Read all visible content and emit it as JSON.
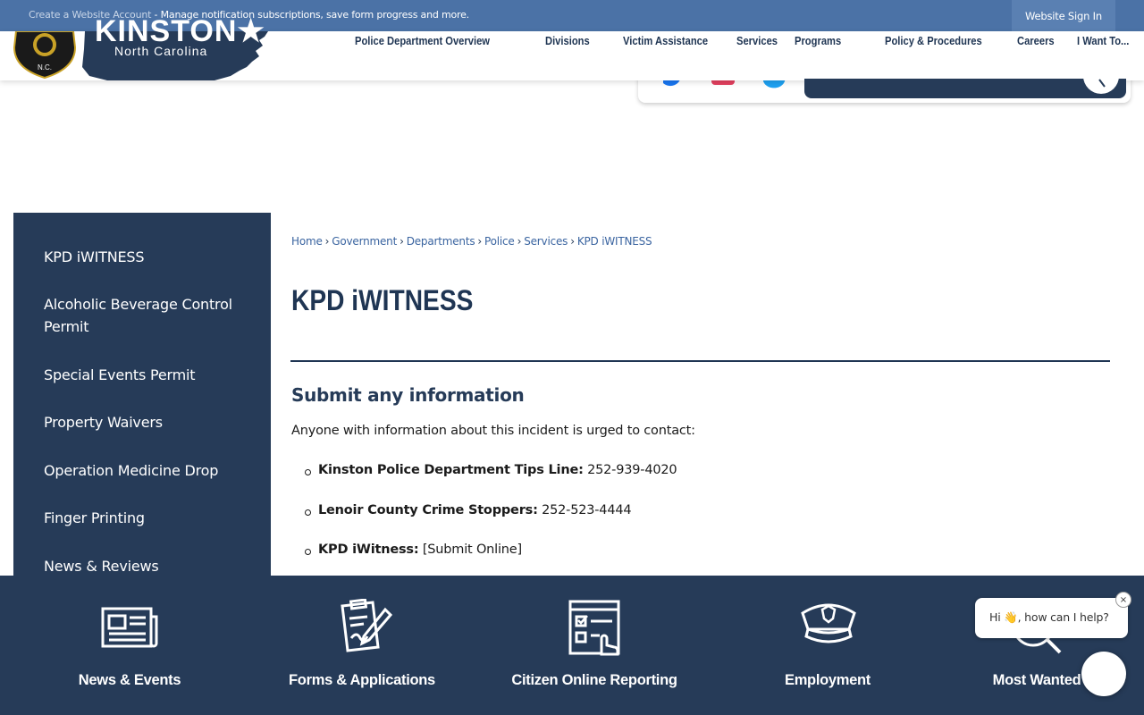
{
  "notification": {
    "link_text": "Create a Website Account",
    "message": " - Manage notification subscriptions, save form progress and more.",
    "signin_label": "Website Sign In"
  },
  "logo": {
    "wordmark": "KINSTON",
    "star": "★",
    "subtitle": "North Carolina",
    "seal_text": "N.C."
  },
  "nav": {
    "items": [
      "Police Department Overview",
      "Divisions",
      "Victim Assistance",
      "Services",
      "Programs",
      "Policy & Procedures",
      "Careers",
      "I Want To..."
    ]
  },
  "sidebar": {
    "items": [
      "KPD iWITNESS",
      "Alcoholic Beverage Control Permit",
      "Special Events Permit",
      "Property Waivers",
      "Operation Medicine Drop",
      "Finger Printing",
      "News & Reviews"
    ]
  },
  "breadcrumb": {
    "items": [
      "Home",
      "Government",
      "Departments",
      "Police",
      "Services",
      "KPD iWITNESS"
    ],
    "separator": "›"
  },
  "page": {
    "title": "KPD iWITNESS",
    "subheading": "Submit any information",
    "intro": "Anyone with information about this incident is urged to contact:",
    "contacts": [
      {
        "label": "Kinston Police Department Tips Line:",
        "value": " 252-939-4020"
      },
      {
        "label": "Lenoir County Crime Stoppers:",
        "value": " 252-523-4444"
      },
      {
        "label": "KPD iWitness:",
        "value": " [Submit Online]"
      }
    ]
  },
  "quick_links": [
    {
      "label": "News & Events",
      "icon": "newspaper-icon"
    },
    {
      "label": "Forms & Applications",
      "icon": "clipboard-pen-icon"
    },
    {
      "label": "Citizen Online Reporting",
      "icon": "online-form-icon"
    },
    {
      "label": "Employment",
      "icon": "police-cap-icon"
    },
    {
      "label": "Most Wanted",
      "icon": "magnifier-person-icon"
    }
  ],
  "chat": {
    "greeting_pre": "Hi ",
    "wave": "👋",
    "greeting_post": ", how can I help?",
    "close": "×"
  },
  "colors": {
    "navy": "#263b58",
    "notification_blue": "#4b72a6",
    "link_blue": "#3a64a0"
  }
}
